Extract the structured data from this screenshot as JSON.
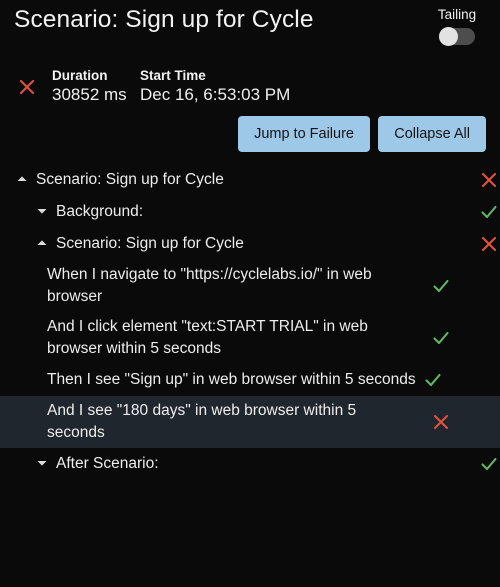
{
  "header": {
    "title": "Scenario: Sign up for Cycle",
    "tailing_label": "Tailing",
    "tailing_on": false
  },
  "summary": {
    "status_icon": "x-icon",
    "duration_label": "Duration",
    "duration_value": "30852 ms",
    "start_time_label": "Start Time",
    "start_time_value": "Dec 16, 6:53:03 PM"
  },
  "toolbar": {
    "jump_to_failure_label": "Jump to Failure",
    "collapse_all_label": "Collapse All"
  },
  "tree": {
    "rows": [
      {
        "label": "Scenario: Sign up for Cycle",
        "level": 1,
        "kind": "node",
        "chevron": "chevron-up-icon",
        "status": "fail"
      },
      {
        "label": "Background:",
        "level": 2,
        "kind": "node",
        "chevron": "chevron-down-icon",
        "status": "pass"
      },
      {
        "label": "Scenario: Sign up for Cycle",
        "level": 2,
        "kind": "node",
        "chevron": "chevron-up-icon",
        "status": "fail"
      },
      {
        "label": "When I navigate to \"https://cyclelabs.io/\" in web browser",
        "level": 3,
        "kind": "step",
        "chevron": "none",
        "status": "pass"
      },
      {
        "label": "And I click element \"text:START TRIAL\" in web browser within 5 seconds",
        "level": 3,
        "kind": "step",
        "chevron": "none",
        "status": "pass"
      },
      {
        "label": "Then I see \"Sign up\" in web browser within 5 seconds",
        "level": 3,
        "kind": "step-inline",
        "chevron": "none",
        "status": "pass"
      },
      {
        "label": "And I see \"180 days\" in web browser within 5 seconds",
        "level": 3,
        "kind": "step",
        "chevron": "none",
        "status": "fail",
        "highlighted": true
      },
      {
        "label": "After Scenario:",
        "level": 2,
        "kind": "node",
        "chevron": "chevron-down-icon",
        "status": "pass"
      }
    ]
  },
  "colors": {
    "background": "#0a0a0a",
    "highlight_row": "#1f262d",
    "button": "#9ec8e8",
    "fail": "#e0523f",
    "pass": "#62b665",
    "text": "#ededed"
  }
}
